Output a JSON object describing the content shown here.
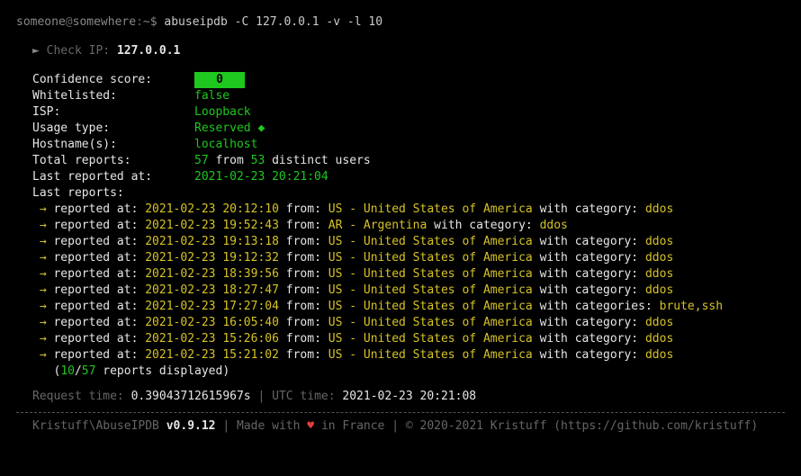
{
  "prompt": {
    "user": "someone",
    "host": "somewhere",
    "path": "~",
    "symbol": "$"
  },
  "command": "abuseipdb -C 127.0.0.1 -v -l 10",
  "header": {
    "tri": "►",
    "label": "Check IP:",
    "ip": "127.0.0.1"
  },
  "fields": {
    "confidence": {
      "label": "Confidence score:",
      "value": "0"
    },
    "whitelisted": {
      "label": "Whitelisted:",
      "value": "false"
    },
    "isp": {
      "label": "ISP:",
      "value": "Loopback"
    },
    "usage": {
      "label": "Usage type:",
      "value": "Reserved",
      "diamond": "◆"
    },
    "hostnames": {
      "label": "Hostname(s):",
      "value": "localhost"
    },
    "total": {
      "label": "Total reports:",
      "count": "57",
      "mid": "from",
      "distinct": "53",
      "tail": "distinct users"
    },
    "lastreported": {
      "label": "Last reported at:",
      "value": "2021-02-23 20:21:04"
    },
    "lastreports": {
      "label": "Last reports:"
    },
    "summary": {
      "open": "(",
      "shown": "10",
      "sep": "/",
      "total": "57",
      "tail": "reports displayed)"
    }
  },
  "t": {
    "arrow": "→",
    "reported_at": "reported at:",
    "from": "from:",
    "with_category": "with category:",
    "with_categories": "with categories:",
    "dash": "-"
  },
  "reports": [
    {
      "time": "2021-02-23 20:12:10",
      "cc": "US",
      "country": "United States of America",
      "catlabel": "with category:",
      "cats": "ddos"
    },
    {
      "time": "2021-02-23 19:52:43",
      "cc": "AR",
      "country": "Argentina",
      "catlabel": "with category:",
      "cats": "ddos"
    },
    {
      "time": "2021-02-23 19:13:18",
      "cc": "US",
      "country": "United States of America",
      "catlabel": "with category:",
      "cats": "ddos"
    },
    {
      "time": "2021-02-23 19:12:32",
      "cc": "US",
      "country": "United States of America",
      "catlabel": "with category:",
      "cats": "ddos"
    },
    {
      "time": "2021-02-23 18:39:56",
      "cc": "US",
      "country": "United States of America",
      "catlabel": "with category:",
      "cats": "ddos"
    },
    {
      "time": "2021-02-23 18:27:47",
      "cc": "US",
      "country": "United States of America",
      "catlabel": "with category:",
      "cats": "ddos"
    },
    {
      "time": "2021-02-23 17:27:04",
      "cc": "US",
      "country": "United States of America",
      "catlabel": "with categories:",
      "cats": "brute,ssh"
    },
    {
      "time": "2021-02-23 16:05:40",
      "cc": "US",
      "country": "United States of America",
      "catlabel": "with category:",
      "cats": "ddos"
    },
    {
      "time": "2021-02-23 15:26:06",
      "cc": "US",
      "country": "United States of America",
      "catlabel": "with category:",
      "cats": "ddos"
    },
    {
      "time": "2021-02-23 15:21:02",
      "cc": "US",
      "country": "United States of America",
      "catlabel": "with category:",
      "cats": "ddos"
    }
  ],
  "footer1": {
    "req_label": "Request time:",
    "req_value": "0.39043712615967s",
    "sep": "|",
    "utc_label": "UTC time:",
    "utc_value": "2021-02-23 20:21:08"
  },
  "footer2": {
    "brand": "Kristuff\\AbuseIPDB",
    "version": "v0.9.12",
    "sep": "|",
    "made_pre": "Made with",
    "heart": "♥",
    "made_post": "in France",
    "copyright": "© 2020-2021 Kristuff (https://github.com/kristuff)"
  }
}
